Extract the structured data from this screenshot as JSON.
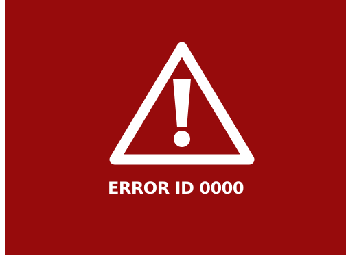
{
  "colors": {
    "panel_background": "#970B0C",
    "foreground": "#FFFFFF",
    "page_background": "#FFFFFF"
  },
  "icon": {
    "name": "warning-triangle-icon"
  },
  "error": {
    "message": "ERROR ID 0000"
  }
}
